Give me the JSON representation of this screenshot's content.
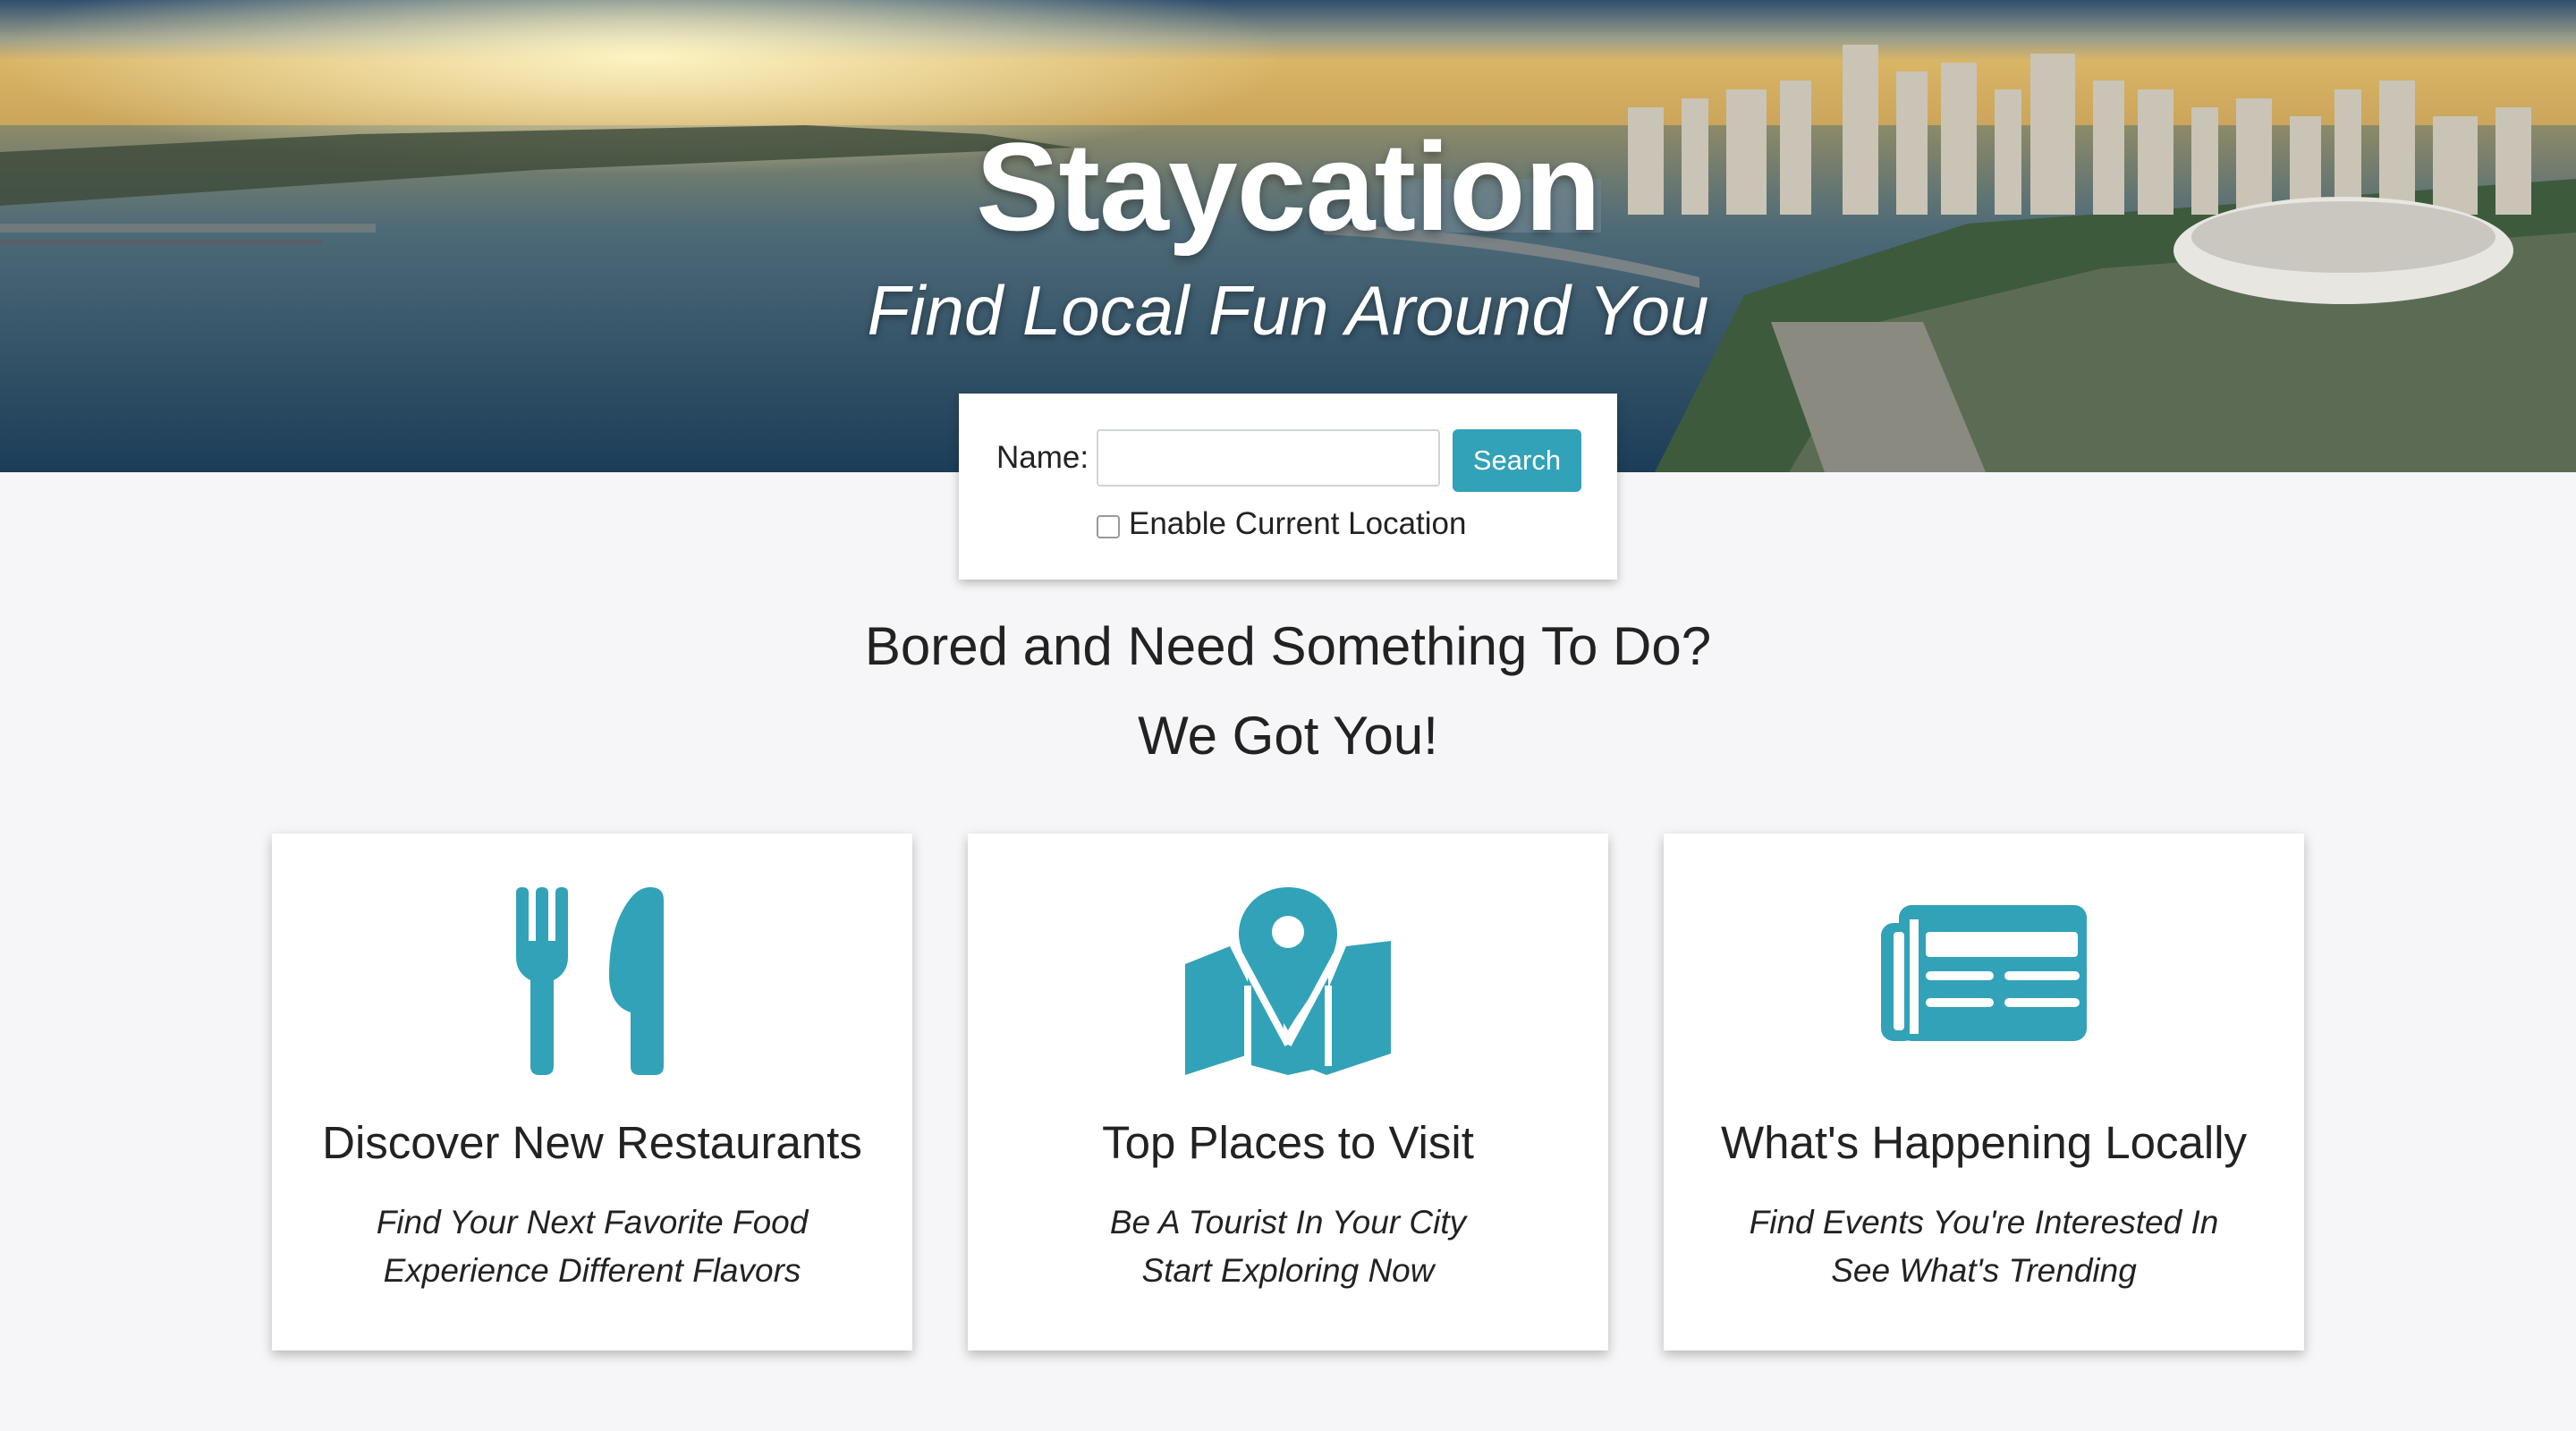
{
  "hero": {
    "title": "Staycation",
    "subtitle": "Find Local Fun Around You"
  },
  "search": {
    "name_label": "Name:",
    "name_value": "",
    "name_placeholder": "",
    "button_label": "Search",
    "location_label": "Enable Current Location",
    "location_checked": false
  },
  "tagline": {
    "line1": "Bored and Need Something To Do?",
    "line2": "We Got You!"
  },
  "accent_color": "#32a2b8",
  "cards": [
    {
      "icon": "utensils-icon",
      "title": "Discover New Restaurants",
      "line1": "Find Your Next Favorite Food",
      "line2": "Experience Different Flavors"
    },
    {
      "icon": "map-marker-icon",
      "title": "Top Places to Visit",
      "line1": "Be A Tourist In Your City",
      "line2": "Start Exploring Now"
    },
    {
      "icon": "newspaper-icon",
      "title": "What's Happening Locally",
      "line1": "Find Events You're Interested In",
      "line2": "See What's Trending"
    }
  ]
}
